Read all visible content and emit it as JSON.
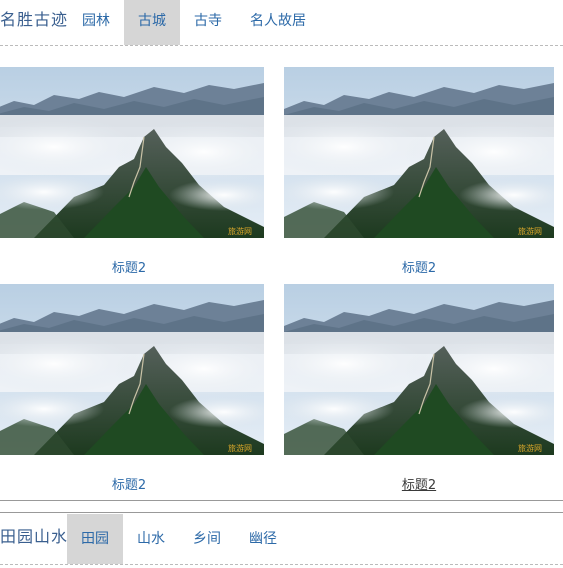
{
  "section1": {
    "title": "名胜古迹",
    "tabs": [
      {
        "label": "园林",
        "active": false
      },
      {
        "label": "古城",
        "active": true
      },
      {
        "label": "古寺",
        "active": false
      },
      {
        "label": "名人故居",
        "active": false
      }
    ]
  },
  "gallery": {
    "items": [
      {
        "caption": "标题2",
        "watermark": "旅游网"
      },
      {
        "caption": "标题2",
        "watermark": "旅游网"
      },
      {
        "caption": "标题2",
        "watermark": "旅游网"
      },
      {
        "caption": "标题2",
        "watermark": "旅游网"
      }
    ]
  },
  "section2": {
    "title": "田园山水",
    "tabs": [
      {
        "label": "田园",
        "active": true
      },
      {
        "label": "山水",
        "active": false
      },
      {
        "label": "乡间",
        "active": false
      },
      {
        "label": "幽径",
        "active": false
      }
    ]
  },
  "colors": {
    "accent": "#2d6aa8",
    "tab_active_bg": "#d6d6d6",
    "title": "#3a5f8f"
  }
}
